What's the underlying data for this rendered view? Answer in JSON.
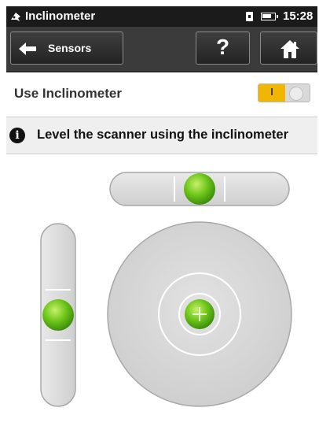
{
  "status_bar": {
    "app_title": "Inclinometer",
    "time": "15:28",
    "icons": [
      "app-icon",
      "sim-icon",
      "battery-icon"
    ]
  },
  "nav": {
    "back_label": "Sensors",
    "back_icon": "arrow-left-icon",
    "help_label": "?",
    "home_icon": "home-icon"
  },
  "settings": {
    "use_inclinometer_label": "Use Inclinometer",
    "toggle_on_text": "I",
    "toggle_state": "on"
  },
  "info": {
    "icon": "info-icon",
    "icon_glyph": "i",
    "message": "Level the scanner using the inclinometer"
  },
  "colors": {
    "accent": "#f2b600",
    "bubble": "#6cc51a",
    "statusbar": "#1b1b1b",
    "navbar": "#3b3b3b"
  }
}
